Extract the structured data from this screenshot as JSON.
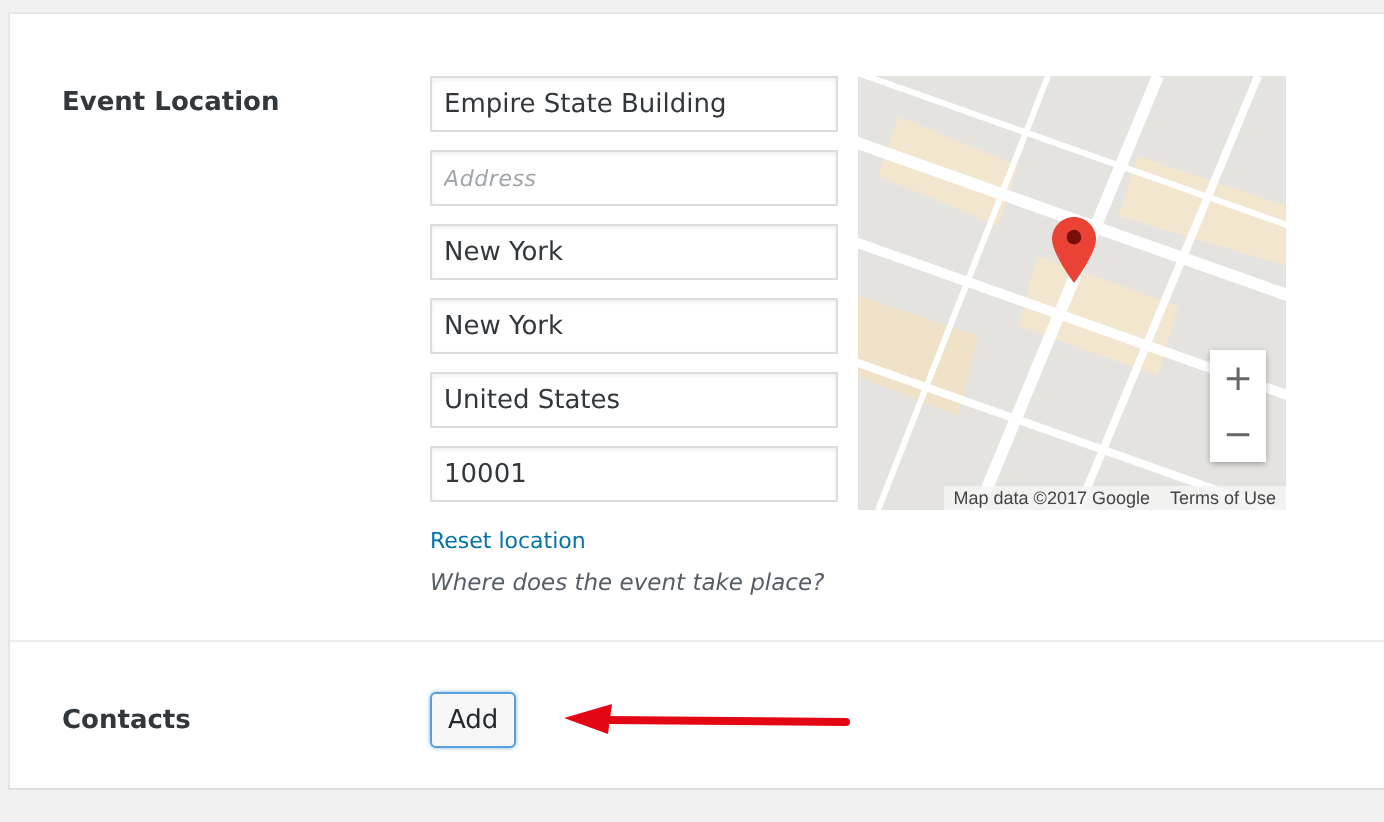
{
  "location": {
    "label": "Event Location",
    "fields": [
      {
        "value": "Empire State Building"
      },
      {
        "placeholder": "Address"
      },
      {
        "value": "New York"
      },
      {
        "value": "New York"
      },
      {
        "value": "United States"
      },
      {
        "value": "10001"
      }
    ],
    "map": {
      "zoom_in": "+",
      "zoom_out": "−",
      "attribution": "Map data ©2017 Google",
      "terms": "Terms of Use"
    },
    "reset_link": "Reset location",
    "hint": "Where does the event take place?"
  },
  "contacts": {
    "label": "Contacts",
    "button": "Add"
  }
}
